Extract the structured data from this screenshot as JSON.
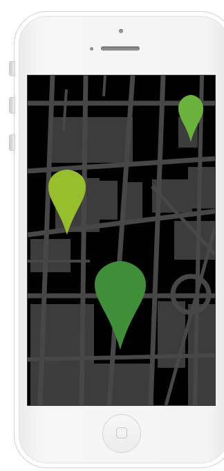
{
  "device": {
    "model": "smartphone",
    "body_color": "#f4f4f4",
    "screen_color": "#000000"
  },
  "map": {
    "background_color": "#000000",
    "block_color": "#3c3c3c",
    "road_color": "#474747",
    "pins": [
      {
        "name": "map-pin-top-right",
        "color": "#6ab23c"
      },
      {
        "name": "map-pin-left",
        "color": "#97be2c"
      },
      {
        "name": "map-pin-center",
        "color": "#3e8f37"
      }
    ]
  },
  "controls": {
    "home_button_icon": "home-button-square-icon",
    "speaker_icon": "earpiece-speaker",
    "camera_icon": "front-camera-icon"
  }
}
